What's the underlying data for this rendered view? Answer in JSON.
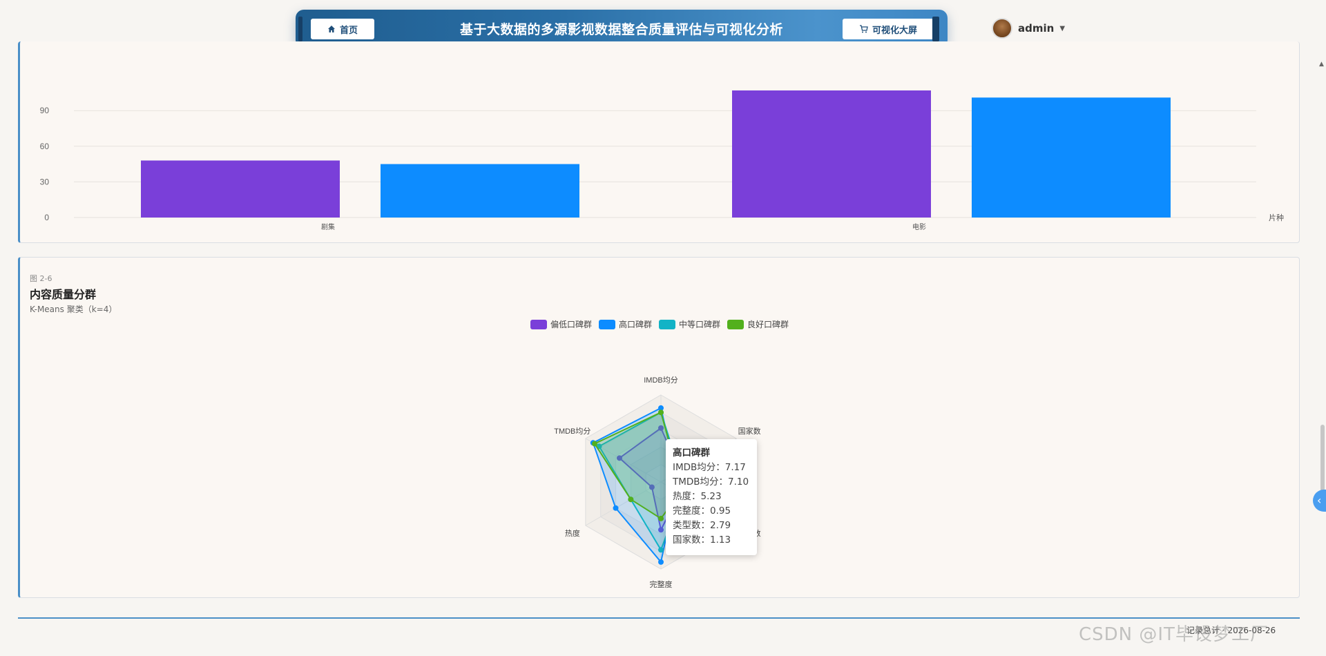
{
  "header": {
    "home_label": "首页",
    "title": "基于大数据的多源影视数据整合质量评估与可视化分析",
    "dashboard_label": "可视化大屏",
    "user_name": "admin"
  },
  "bar_chart": {
    "chart_data": {
      "type": "bar",
      "categories": [
        "剧集",
        "电影"
      ],
      "series": [
        {
          "name": "",
          "values": [
            48,
            107
          ],
          "color": "#7a3fd9"
        },
        {
          "name": "",
          "values": [
            45,
            101
          ],
          "color": "#0d8cff"
        }
      ],
      "y_ticks": [
        "0",
        "30",
        "60",
        "90"
      ],
      "ylabel": "片种",
      "ylim": [
        0,
        107
      ]
    }
  },
  "radar": {
    "tag": "图 2-6",
    "title": "内容质量分群",
    "subtitle": "K-Means 聚类（k=4）",
    "legend": [
      {
        "name": "偏低口碑群",
        "color": "#7a3fd9"
      },
      {
        "name": "高口碑群",
        "color": "#0d8cff"
      },
      {
        "name": "中等口碑群",
        "color": "#12b3c6"
      },
      {
        "name": "良好口碑群",
        "color": "#52b01d"
      }
    ],
    "axes": [
      "IMDB均分",
      "国家数",
      "类型数",
      "完整度",
      "热度",
      "TMDB均分"
    ],
    "chart_data": {
      "type": "radar",
      "indicators": [
        "IMDB均分",
        "国家数",
        "类型数",
        "完整度",
        "热度",
        "TMDB均分"
      ],
      "series": [
        {
          "name": "偏低口碑群",
          "values": [
            0.62,
            0.25,
            0.25,
            0.55,
            0.12,
            0.55
          ]
        },
        {
          "name": "高口碑群",
          "values": [
            0.85,
            0.2,
            0.2,
            0.92,
            0.6,
            0.9
          ]
        },
        {
          "name": "中等口碑群",
          "values": [
            0.8,
            0.25,
            0.28,
            0.78,
            0.4,
            0.82
          ]
        },
        {
          "name": "良好口碑群",
          "values": [
            0.8,
            0.22,
            0.25,
            0.42,
            0.4,
            0.88
          ]
        }
      ]
    },
    "tooltip": {
      "title": "高口碑群",
      "lines": [
        "IMDB均分：7.17",
        "TMDB均分：7.10",
        "热度：5.23",
        "完整度：0.95",
        "类型数：2.79",
        "国家数：1.13"
      ]
    }
  },
  "footer": {
    "text": "记录总计 · 2026-08-26",
    "watermark": "CSDN @IT毕设梦工厂"
  }
}
